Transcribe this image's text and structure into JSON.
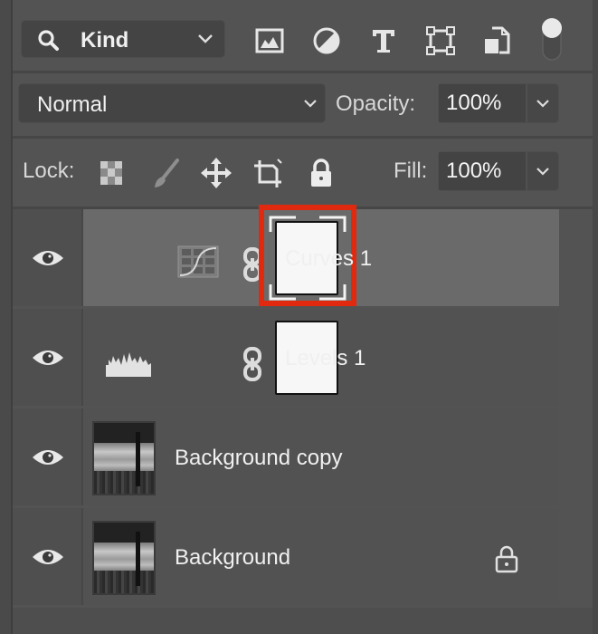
{
  "filter": {
    "kind_label": "Kind",
    "icons": [
      "image-filter-icon",
      "adjustment-filter-icon",
      "type-filter-icon",
      "shape-filter-icon",
      "smart-object-filter-icon"
    ],
    "filter_toggle": "on"
  },
  "blend": {
    "mode": "Normal",
    "opacity_label": "Opacity:",
    "opacity_value": "100%"
  },
  "lock": {
    "label": "Lock:",
    "icons": [
      "lock-transparent-pixels-icon",
      "lock-image-pixels-icon",
      "lock-position-icon",
      "lock-artboard-icon",
      "lock-all-icon"
    ],
    "fill_label": "Fill:",
    "fill_value": "100%"
  },
  "layers": [
    {
      "name": "Curves 1",
      "type": "curves-adjustment",
      "visible": true,
      "selected": true,
      "mask": true,
      "highlighted": true,
      "highlight_color": "#e0290f"
    },
    {
      "name": "Levels 1",
      "type": "levels-adjustment",
      "visible": true,
      "selected": false,
      "mask": true
    },
    {
      "name": "Background copy",
      "type": "image",
      "visible": true,
      "selected": false
    },
    {
      "name": "Background",
      "type": "image",
      "visible": true,
      "selected": false,
      "locked": true
    }
  ]
}
